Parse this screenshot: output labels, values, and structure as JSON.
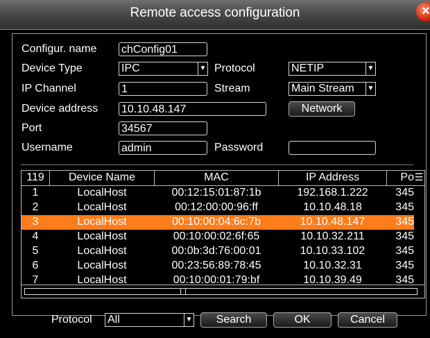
{
  "dialog": {
    "title": "Remote access configuration"
  },
  "form": {
    "config_name_label": "Configur. name",
    "config_name_value": "chConfig01",
    "device_type_label": "Device Type",
    "device_type_value": "IPC",
    "protocol_label": "Protocol",
    "protocol_value": "NETIP",
    "ip_channel_label": "IP Channel",
    "ip_channel_value": "1",
    "stream_label": "Stream",
    "stream_value": "Main Stream",
    "device_address_label": "Device address",
    "device_address_value": "10.10.48.147",
    "network_button": "Network",
    "port_label": "Port",
    "port_value": "34567",
    "username_label": "Username",
    "username_value": "admin",
    "password_label": "Password",
    "password_value": ""
  },
  "table": {
    "headers": [
      "119",
      "Device Name",
      "MAC",
      "IP Address",
      "Po"
    ],
    "selected_row": 3,
    "rows": [
      [
        "1",
        "LocalHost",
        "00:12:15:01:87:1b",
        "192.168.1.222",
        "345"
      ],
      [
        "2",
        "LocalHost",
        "00:12:00:00:96:ff",
        "10.10.48.18",
        "345"
      ],
      [
        "3",
        "LocalHost",
        "00:10:00:04:6c:7b",
        "10.10.48.147",
        "345"
      ],
      [
        "4",
        "LocalHost",
        "00:10:00:02:6f:65",
        "10.10.32.211",
        "345"
      ],
      [
        "5",
        "LocalHost",
        "00:0b:3d:76:00:01",
        "10.10.33.102",
        "345"
      ],
      [
        "6",
        "LocalHost",
        "00:23:56:89:78:45",
        "10.10.32.31",
        "345"
      ],
      [
        "7",
        "LocalHost",
        "00:10:00:01:79:bf",
        "10.10.39.49",
        "345"
      ]
    ]
  },
  "footer": {
    "protocol_label": "Protocol",
    "protocol_value": "All",
    "search_button": "Search",
    "ok_button": "OK",
    "cancel_button": "Cancel"
  },
  "colors": {
    "selected_row": "#ff7c1b",
    "background": "#000000",
    "text": "#ffffff"
  }
}
